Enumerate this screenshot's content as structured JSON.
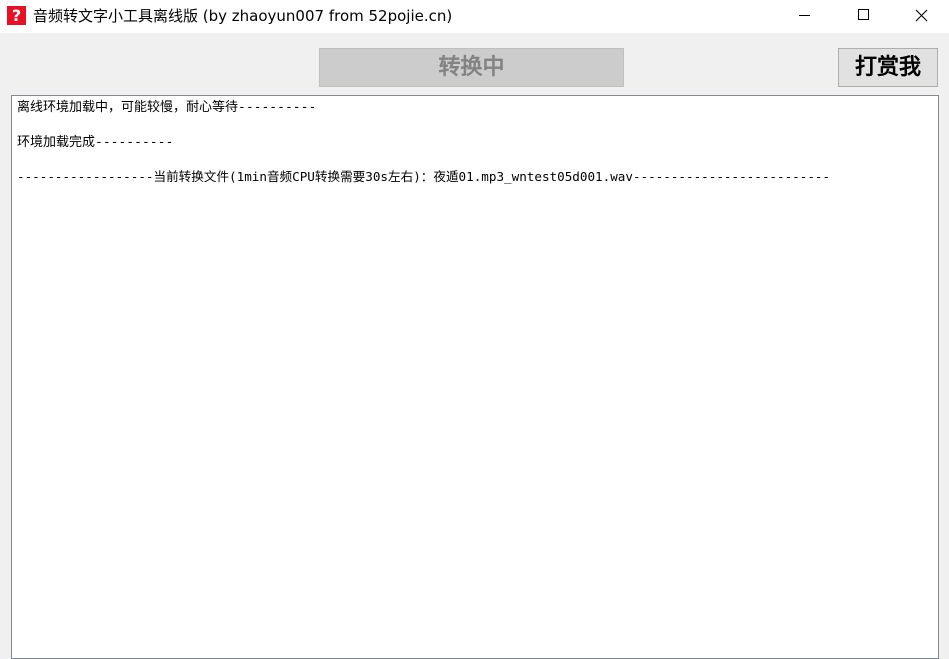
{
  "window": {
    "icon_glyph": "?",
    "icon_name": "question-app-icon",
    "title": "音频转文字小工具离线版 (by zhaoyun007 from 52pojie.cn)",
    "controls": [
      "minimize",
      "maximize",
      "close"
    ]
  },
  "toolbar": {
    "convert_label": "转换中",
    "donate_label": "打赏我"
  },
  "log": {
    "lines": [
      "离线环境加载中，可能较慢，耐心等待----------",
      "环境加载完成----------",
      "------------------当前转换文件(1min音频CPU转换需要30s左右)：夜遁01.mp3_wntest05d001.wav--------------------------"
    ]
  },
  "colors": {
    "close_icon": "#000000",
    "disabled_button_bg": "#cccccc",
    "disabled_button_text": "#838383",
    "app_icon_bg": "#e81123"
  }
}
